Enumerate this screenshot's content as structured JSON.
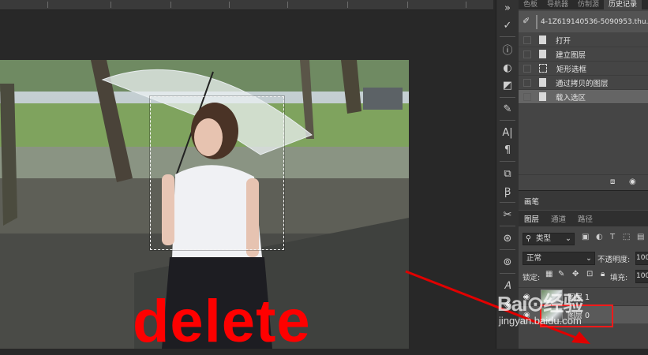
{
  "panel_tabs": [
    "色板",
    "导航器",
    "仿制源",
    "历史记录"
  ],
  "history": {
    "snapshot_label": "4-1Z619140536-5090953.thu...",
    "items": [
      {
        "label": "打开",
        "icon": "document-icon"
      },
      {
        "label": "建立图层",
        "icon": "document-icon"
      },
      {
        "label": "矩形选框",
        "icon": "marquee-icon"
      },
      {
        "label": "通过拷贝的图层",
        "icon": "document-icon"
      },
      {
        "label": "载入选区",
        "icon": "document-icon",
        "selected": true
      }
    ]
  },
  "brush_panel": {
    "label": "画笔"
  },
  "layers_panel": {
    "tabs": [
      "图层",
      "通道",
      "路径"
    ],
    "kind_filter": "类型",
    "blend_mode": "正常",
    "opacity_label": "不透明度:",
    "opacity_value": "100",
    "lock_label": "锁定:",
    "fill_label": "填充:",
    "fill_value": "100",
    "layers": [
      {
        "name": "图层 1"
      },
      {
        "name": "图层 0"
      }
    ]
  },
  "annotation": {
    "text": "delete",
    "color": "#ff0000"
  },
  "watermark": {
    "logo": "Bai⊙经验",
    "url": "jingyan.baidu.com"
  }
}
